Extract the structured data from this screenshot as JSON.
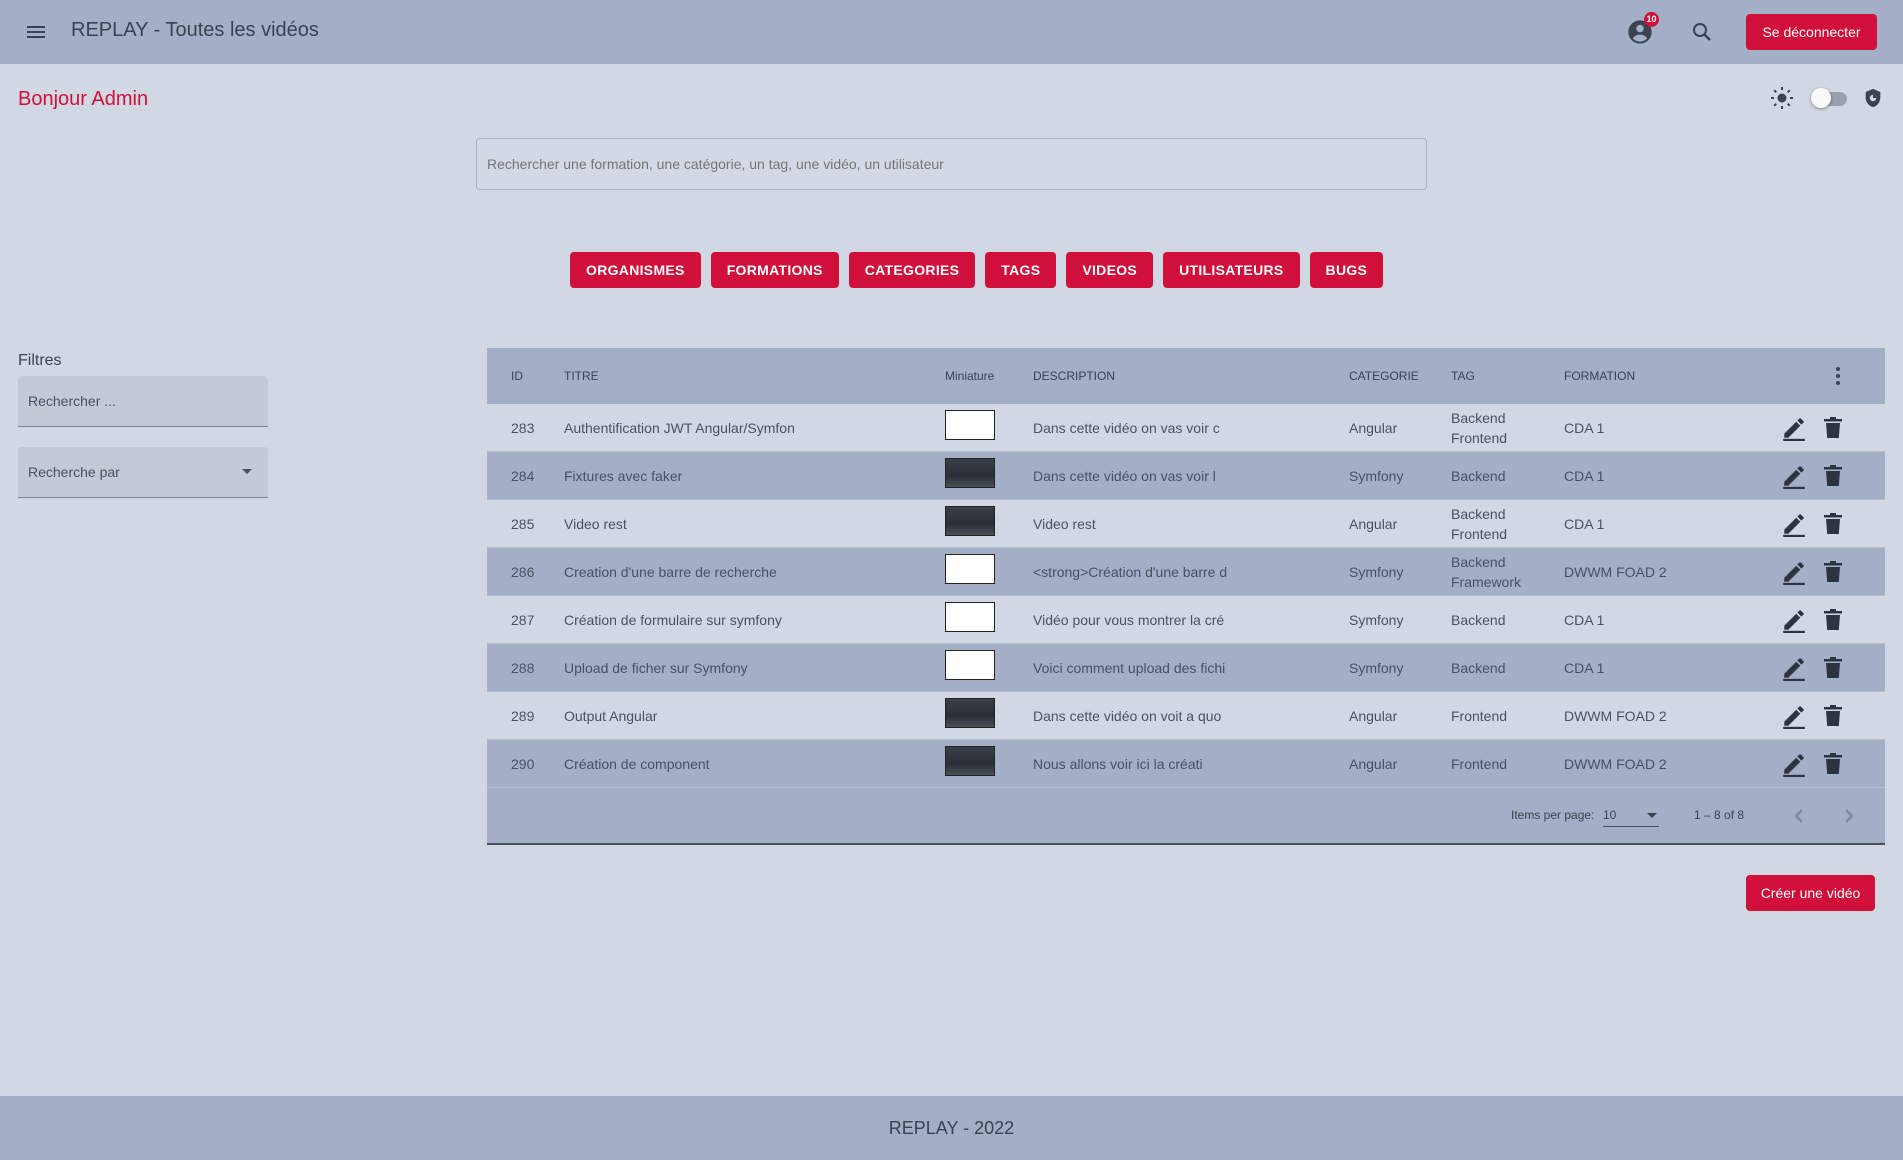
{
  "header": {
    "title": "REPLAY - Toutes les vidéos",
    "notification_count": "10",
    "logout_label": "Se déconnecter",
    "bg_color": "#a3afc7",
    "accent_color": "#d0103a"
  },
  "greeting": "Bonjour Admin",
  "search": {
    "placeholder": "Rechercher une formation, une catégorie, un tag, une vidéo, un utilisateur"
  },
  "nav": [
    "ORGANISMES",
    "FORMATIONS",
    "CATEGORIES",
    "TAGS",
    "VIDEOS",
    "UTILISATEURS",
    "BUGS"
  ],
  "filters": {
    "title": "Filtres",
    "search_placeholder": "Rechercher ...",
    "select_label": "Recherche par"
  },
  "table": {
    "headers": {
      "id": "ID",
      "titre": "TITRE",
      "miniature": "Miniature",
      "description": "DESCRIPTION",
      "categorie": "CATEGORIE",
      "tag": "TAG",
      "formation": "FORMATION"
    },
    "rows": [
      {
        "id": "283",
        "titre": "Authentification JWT Angular/Symfon",
        "thumb": "light",
        "description": "Dans cette vidéo on vas voir c",
        "categorie": "Angular",
        "tag1": "Backend",
        "tag2": "Frontend",
        "formation": "CDA 1"
      },
      {
        "id": "284",
        "titre": "Fixtures avec faker",
        "thumb": "dark",
        "description": "Dans cette vidéo on vas voir l",
        "categorie": "Symfony",
        "tag1": "Backend",
        "tag2": "",
        "formation": "CDA 1"
      },
      {
        "id": "285",
        "titre": "Video rest",
        "thumb": "dark",
        "description": "Video rest",
        "categorie": "Angular",
        "tag1": "Backend",
        "tag2": "Frontend",
        "formation": "CDA 1"
      },
      {
        "id": "286",
        "titre": "Creation d'une barre de recherche",
        "thumb": "light",
        "description": "<strong>Création d'une barre d",
        "categorie": "Symfony",
        "tag1": "Backend",
        "tag2": "Framework",
        "formation": "DWWM FOAD 2"
      },
      {
        "id": "287",
        "titre": "Création de formulaire sur symfony",
        "thumb": "light",
        "description": "Vidéo pour vous montrer la cré",
        "categorie": "Symfony",
        "tag1": "Backend",
        "tag2": "",
        "formation": "CDA 1"
      },
      {
        "id": "288",
        "titre": "Upload de ficher sur Symfony",
        "thumb": "light",
        "description": "Voici comment upload des fichi",
        "categorie": "Symfony",
        "tag1": "Backend",
        "tag2": "",
        "formation": "CDA 1"
      },
      {
        "id": "289",
        "titre": "Output Angular",
        "thumb": "dark",
        "description": "Dans cette vidéo on voit a quo",
        "categorie": "Angular",
        "tag1": "Frontend",
        "tag2": "",
        "formation": "DWWM FOAD 2"
      },
      {
        "id": "290",
        "titre": "Création de component",
        "thumb": "dark",
        "description": "Nous allons voir ici la créati",
        "categorie": "Angular",
        "tag1": "Frontend",
        "tag2": "",
        "formation": "DWWM FOAD 2"
      }
    ]
  },
  "paginator": {
    "items_per_page_label": "Items per page:",
    "items_per_page_value": "10",
    "range_label": "1 – 8 of 8"
  },
  "create_button_label": "Créer une vidéo",
  "footer": "REPLAY - 2022"
}
